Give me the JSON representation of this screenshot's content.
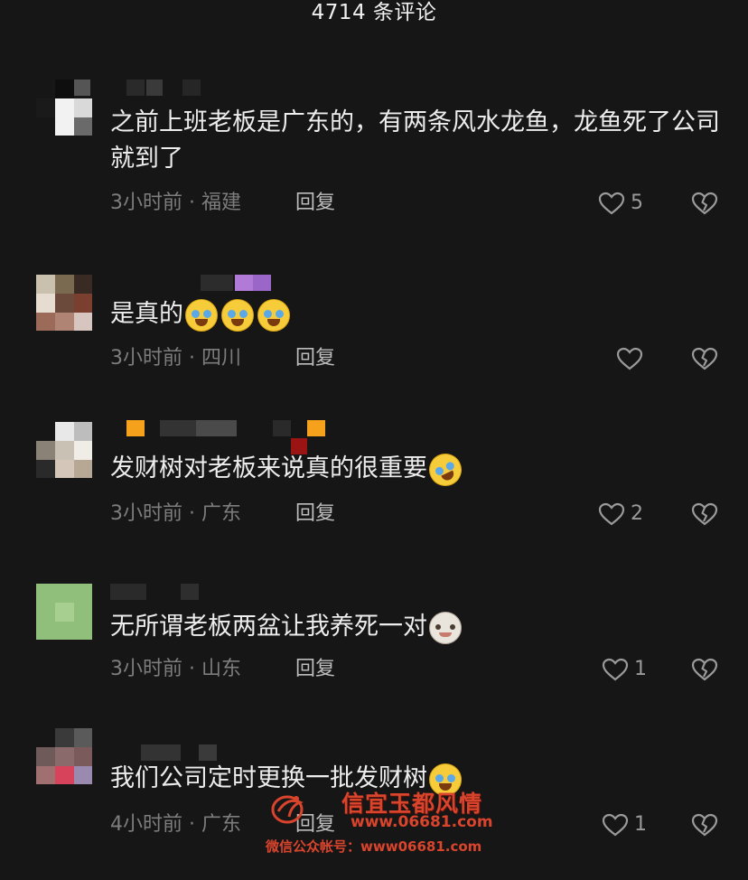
{
  "header": {
    "title": "4714 条评论"
  },
  "comments": [
    {
      "text": "之前上班老板是广东的，有两条风水龙鱼，龙鱼死了公司就到了",
      "emojis": [],
      "meta": "3小时前 · 福建",
      "reply_label": "回复",
      "like_count": "5"
    },
    {
      "text": "是真的",
      "emojis": [
        "crying-laughing-emoji",
        "crying-laughing-emoji",
        "crying-laughing-emoji"
      ],
      "meta": "3小时前 · 四川",
      "reply_label": "回复",
      "like_count": ""
    },
    {
      "text": "发财树对老板来说真的很重要",
      "emojis": [
        "rolling-laughing-emoji"
      ],
      "meta": "3小时前 · 广东",
      "reply_label": "回复",
      "like_count": "2"
    },
    {
      "text": "无所谓老板两盆让我养死一对",
      "emojis": [
        "cat-emoji"
      ],
      "meta": "3小时前 · 山东",
      "reply_label": "回复",
      "like_count": "1"
    },
    {
      "text": "我们公司定时更换一批发财树",
      "emojis": [
        "crying-laughing-emoji"
      ],
      "meta": "4小时前 · 广东",
      "reply_label": "回复",
      "like_count": "1"
    }
  ],
  "watermark": {
    "title": "信宜玉都风情",
    "site": "www.06681.com",
    "account": "微信公众帐号：www06681.com"
  },
  "colors": {
    "background": "#161616",
    "text": "#ededed",
    "meta": "#7d7d7d",
    "watermark": "#d9442d"
  }
}
